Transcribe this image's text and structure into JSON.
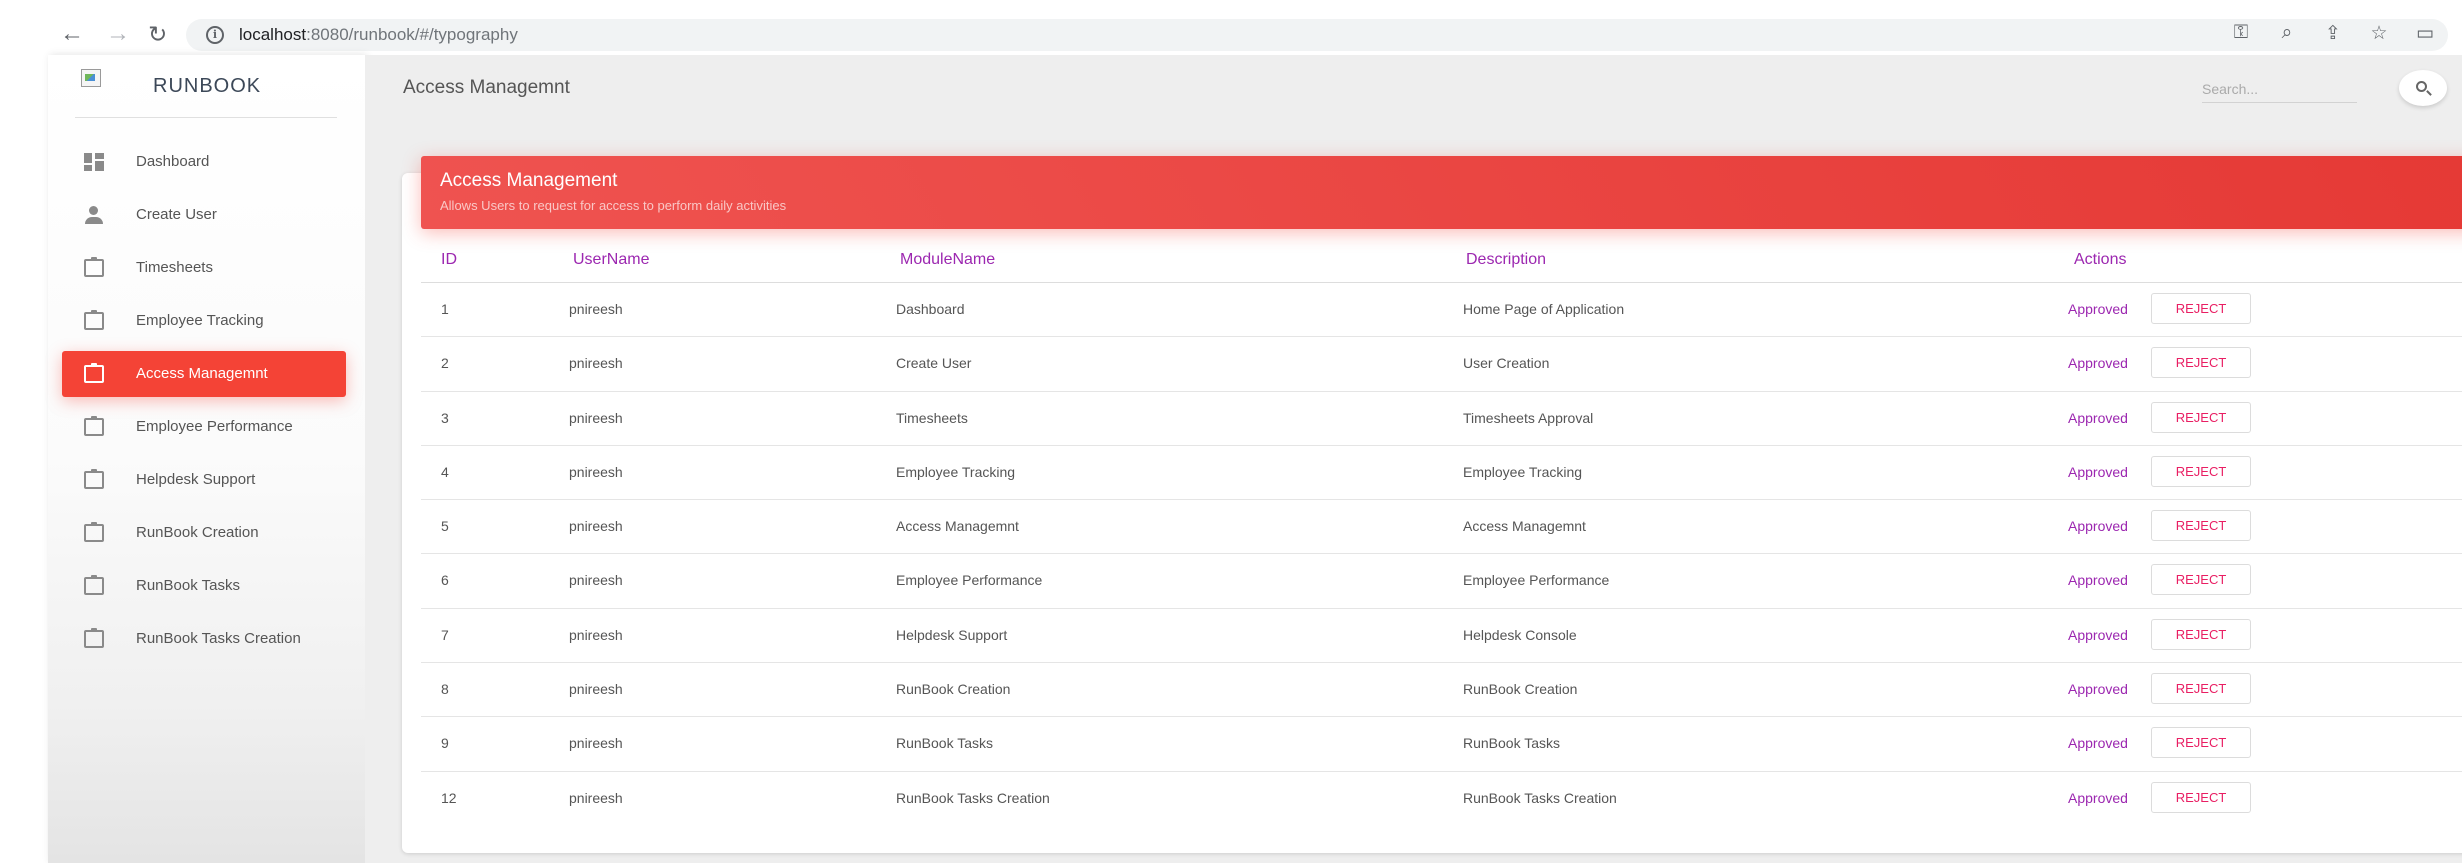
{
  "browser": {
    "url_host": "localhost",
    "url_rest": ":8080/runbook/#/typography"
  },
  "sidebar": {
    "brand": "RUNBOOK",
    "items": [
      {
        "label": "Dashboard",
        "icon": "dashboard-icon"
      },
      {
        "label": "Create User",
        "icon": "person-icon"
      },
      {
        "label": "Timesheets",
        "icon": "clipboard-icon"
      },
      {
        "label": "Employee Tracking",
        "icon": "clipboard-icon"
      },
      {
        "label": "Access Managemnt",
        "icon": "clipboard-icon",
        "active": true
      },
      {
        "label": "Employee Performance",
        "icon": "clipboard-icon"
      },
      {
        "label": "Helpdesk Support",
        "icon": "clipboard-icon"
      },
      {
        "label": "RunBook Creation",
        "icon": "clipboard-icon"
      },
      {
        "label": "RunBook Tasks",
        "icon": "clipboard-icon"
      },
      {
        "label": "RunBook Tasks Creation",
        "icon": "clipboard-icon"
      }
    ]
  },
  "header": {
    "title": "Access Managemnt",
    "search_placeholder": "Search..."
  },
  "card": {
    "title": "Access Management",
    "subtitle": "Allows Users to request for access to perform daily activities"
  },
  "table": {
    "columns": [
      "ID",
      "UserName",
      "ModuleName",
      "Description",
      "Actions"
    ],
    "approved_label": "Approved",
    "reject_label": "REJECT",
    "rows": [
      {
        "id": "1",
        "user": "pnireesh",
        "module": "Dashboard",
        "description": "Home Page of Application"
      },
      {
        "id": "2",
        "user": "pnireesh",
        "module": "Create User",
        "description": "User Creation"
      },
      {
        "id": "3",
        "user": "pnireesh",
        "module": "Timesheets",
        "description": "Timesheets Approval"
      },
      {
        "id": "4",
        "user": "pnireesh",
        "module": "Employee Tracking",
        "description": "Employee Tracking"
      },
      {
        "id": "5",
        "user": "pnireesh",
        "module": "Access Managemnt",
        "description": "Access Managemnt"
      },
      {
        "id": "6",
        "user": "pnireesh",
        "module": "Employee Performance",
        "description": "Employee Performance"
      },
      {
        "id": "7",
        "user": "pnireesh",
        "module": "Helpdesk Support",
        "description": "Helpdesk Console"
      },
      {
        "id": "8",
        "user": "pnireesh",
        "module": "RunBook Creation",
        "description": "RunBook Creation"
      },
      {
        "id": "9",
        "user": "pnireesh",
        "module": "RunBook Tasks",
        "description": "RunBook Tasks"
      },
      {
        "id": "12",
        "user": "pnireesh",
        "module": "RunBook Tasks Creation",
        "description": "RunBook Tasks Creation"
      }
    ]
  },
  "colors": {
    "accent": "#f44336",
    "table_header": "#9c27b0",
    "reject": "#e91e63"
  }
}
